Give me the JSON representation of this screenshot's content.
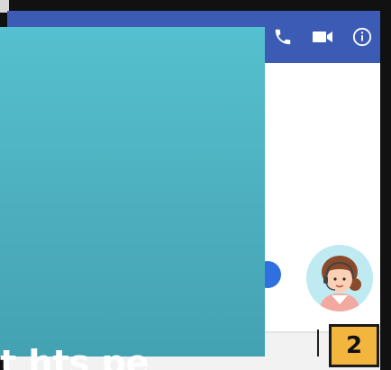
{
  "header": {
    "icons": [
      "phone-icon",
      "video-camera-icon",
      "info-icon"
    ]
  },
  "step_badge": {
    "number": "2"
  },
  "caption": {
    "text": "t hts pe"
  },
  "colors": {
    "header": "#3b5bb5",
    "overlay": "#4fb5c4",
    "badge": "#f2b53d",
    "avatar_bg": "#bfeaf1"
  }
}
